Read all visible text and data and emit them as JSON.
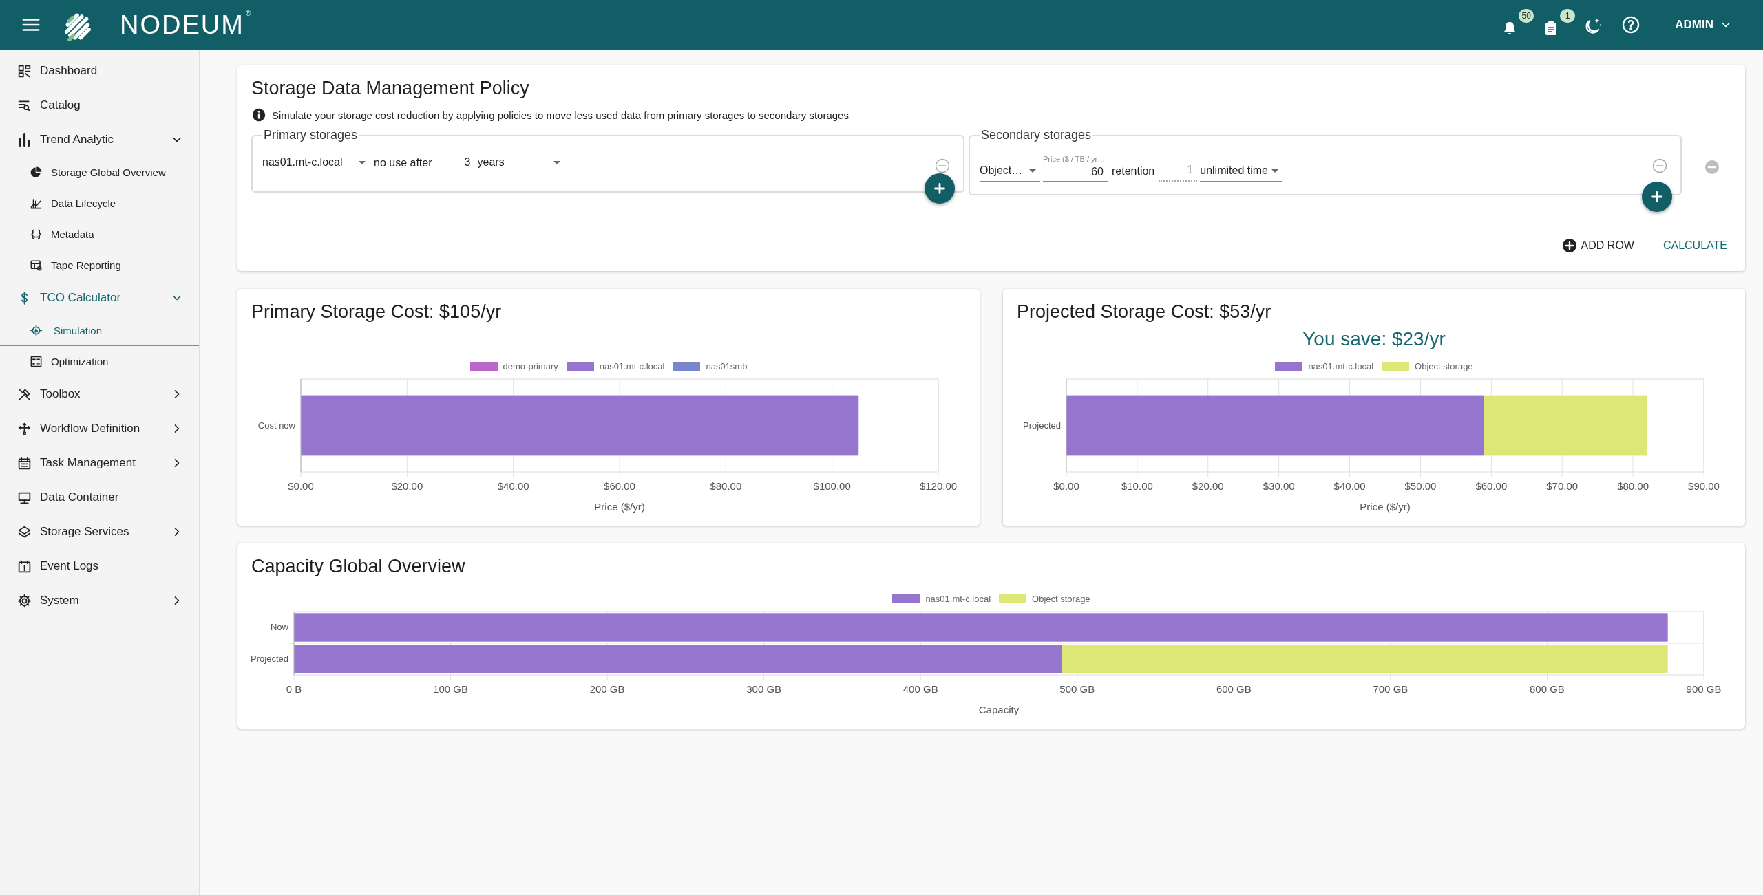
{
  "header": {
    "logo_text": "NODEUM",
    "logo_mark": "®",
    "notifications_badge": "50",
    "tasks_badge": "1",
    "user": "ADMIN"
  },
  "sidebar": {
    "items": [
      {
        "label": "Dashboard",
        "selected": false
      },
      {
        "label": "Catalog",
        "selected": false
      },
      {
        "label": "Trend Analytic",
        "selected": false,
        "expanded": true,
        "children": [
          {
            "label": "Storage Global Overview",
            "selected": false
          },
          {
            "label": "Data Lifecycle",
            "selected": false
          },
          {
            "label": "Metadata",
            "selected": false
          },
          {
            "label": "Tape Reporting",
            "selected": false
          }
        ]
      },
      {
        "label": "TCO Calculator",
        "selected": false,
        "expanded": true,
        "children": [
          {
            "label": "Simulation",
            "selected": true
          },
          {
            "label": "Optimization",
            "selected": false
          }
        ]
      },
      {
        "label": "Toolbox",
        "selected": false,
        "expanded": false
      },
      {
        "label": "Workflow Definition",
        "selected": false,
        "expanded": false
      },
      {
        "label": "Task Management",
        "selected": false,
        "expanded": false
      },
      {
        "label": "Data Container",
        "selected": false
      },
      {
        "label": "Storage Services",
        "selected": false,
        "expanded": false
      },
      {
        "label": "Event Logs",
        "selected": false
      },
      {
        "label": "System",
        "selected": false,
        "expanded": false
      }
    ]
  },
  "policy": {
    "title": "Storage Data Management Policy",
    "info": "Simulate your storage cost reduction by applying policies to move less used data from primary storages to secondary storages",
    "primary": {
      "legend": "Primary storages",
      "rows": [
        {
          "storage": "nas01.mt-c.local",
          "label": "no use after",
          "amount": "3",
          "unit": "years"
        }
      ]
    },
    "secondary": {
      "legend": "Secondary storages",
      "rows": [
        {
          "storage": "Object…",
          "price_label": "Price ($ / TB / yr…",
          "price": "60",
          "label": "retention",
          "retention": "1",
          "retention_disabled": true,
          "unit": "unlimited time"
        }
      ]
    },
    "actions": [
      "ADD ROW",
      "CALCULATE"
    ]
  },
  "primary_cost": {
    "title": "Primary Storage Cost: $105/yr",
    "chart_data": {
      "type": "bar",
      "orientation": "horizontal",
      "stacked": true,
      "grid": true,
      "legend": true,
      "xlabel": "Price ($/yr)",
      "categories": [
        "Cost now"
      ],
      "series": [
        {
          "name": "demo-primary",
          "color": "#ba68c8",
          "values": [
            null
          ]
        },
        {
          "name": "nas01.mt-c.local",
          "color": "#9575cd",
          "values": [
            105
          ]
        },
        {
          "name": "nas01smb",
          "color": "#7986cb",
          "values": [
            null
          ]
        }
      ],
      "xlim": [
        0,
        120
      ],
      "xticks": [
        {
          "value": 0,
          "label": "$0.00"
        },
        {
          "value": 20,
          "label": "$20.00"
        },
        {
          "value": 40,
          "label": "$40.00"
        },
        {
          "value": 60,
          "label": "$60.00"
        },
        {
          "value": 80,
          "label": "$80.00"
        },
        {
          "value": 100,
          "label": "$100.00"
        },
        {
          "value": 120,
          "label": "$120.00"
        }
      ]
    }
  },
  "projected_cost": {
    "title": "Projected Storage Cost: $53/yr",
    "savings": "You save: $23/yr",
    "chart_data": {
      "type": "bar",
      "orientation": "horizontal",
      "stacked": true,
      "grid": true,
      "legend": true,
      "xlabel": "Price ($/yr)",
      "categories": [
        "Projected"
      ],
      "series": [
        {
          "name": "nas01.mt-c.local",
          "color": "#9575cd",
          "values": [
            59
          ]
        },
        {
          "name": "Object storage",
          "color": "#dce775",
          "values": [
            23
          ]
        }
      ],
      "xlim": [
        0,
        90
      ],
      "xticks": [
        {
          "value": 0,
          "label": "$0.00"
        },
        {
          "value": 10,
          "label": "$10.00"
        },
        {
          "value": 20,
          "label": "$20.00"
        },
        {
          "value": 30,
          "label": "$30.00"
        },
        {
          "value": 40,
          "label": "$40.00"
        },
        {
          "value": 50,
          "label": "$50.00"
        },
        {
          "value": 60,
          "label": "$60.00"
        },
        {
          "value": 70,
          "label": "$70.00"
        },
        {
          "value": 80,
          "label": "$80.00"
        },
        {
          "value": 90,
          "label": "$90.00"
        }
      ]
    }
  },
  "capacity": {
    "title": "Capacity Global Overview",
    "chart_data": {
      "type": "bar",
      "orientation": "horizontal",
      "stacked": true,
      "grid": true,
      "legend": true,
      "xlabel": "Capacity",
      "categories": [
        "Now",
        "Projected"
      ],
      "series": [
        {
          "name": "nas01.mt-c.local",
          "color": "#9575cd",
          "values": [
            877,
            490
          ]
        },
        {
          "name": "Object storage",
          "color": "#dce775",
          "values": [
            null,
            387
          ]
        }
      ],
      "xlim": [
        0,
        900
      ],
      "xticks": [
        {
          "value": 0,
          "label": "0 B"
        },
        {
          "value": 100,
          "label": "100 GB"
        },
        {
          "value": 200,
          "label": "200 GB"
        },
        {
          "value": 300,
          "label": "300 GB"
        },
        {
          "value": 400,
          "label": "400 GB"
        },
        {
          "value": 500,
          "label": "500 GB"
        },
        {
          "value": 600,
          "label": "600 GB"
        },
        {
          "value": 700,
          "label": "700 GB"
        },
        {
          "value": 800,
          "label": "800 GB"
        },
        {
          "value": 900,
          "label": "900 GB"
        }
      ]
    }
  }
}
